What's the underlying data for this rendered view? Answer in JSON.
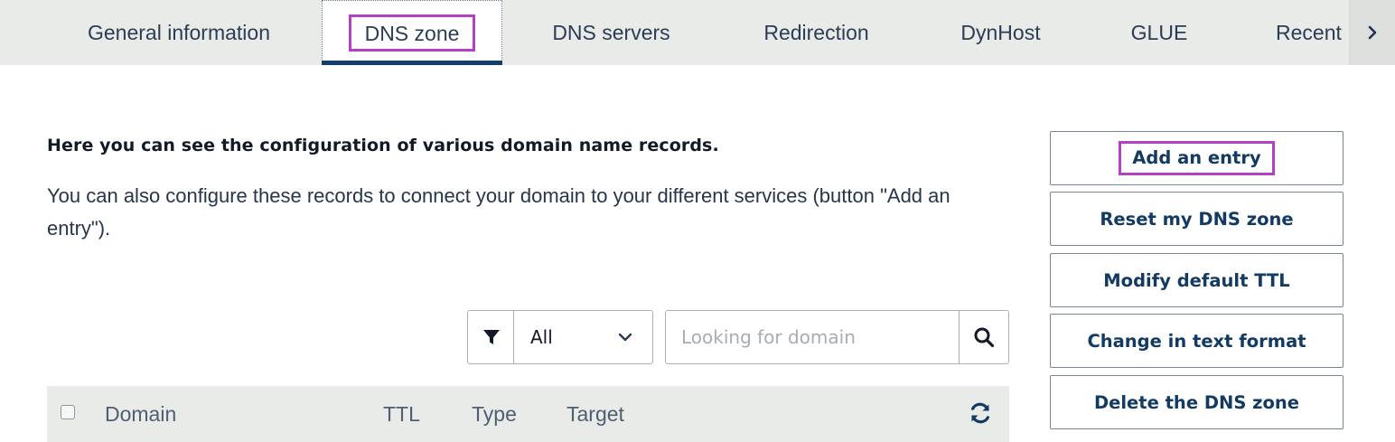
{
  "tabs": [
    {
      "label": "General information"
    },
    {
      "label": "DNS zone",
      "active": true
    },
    {
      "label": "DNS servers"
    },
    {
      "label": "Redirection"
    },
    {
      "label": "DynHost"
    },
    {
      "label": "GLUE"
    },
    {
      "label": "Recent"
    }
  ],
  "intro": {
    "heading": "Here you can see the configuration of various domain name records.",
    "body": "You can also configure these records to connect your domain to your different services (button \"Add an entry\")."
  },
  "actions": {
    "add_entry": "Add an entry",
    "reset_zone": "Reset my DNS zone",
    "modify_ttl": "Modify default TTL",
    "text_format": "Change in text format",
    "delete_zone": "Delete the DNS zone"
  },
  "filter": {
    "icon": "filter-icon",
    "selected": "All"
  },
  "search": {
    "placeholder": "Looking for domain",
    "value": "",
    "icon": "search-icon"
  },
  "table": {
    "columns": [
      "Domain",
      "TTL",
      "Type",
      "Target"
    ],
    "refresh_icon": "refresh-icon"
  },
  "colors": {
    "tab_bar_bg": "#e9ebe8",
    "active_underline": "#113f6e",
    "highlight_box": "#b440c4",
    "button_text": "#123a63"
  }
}
